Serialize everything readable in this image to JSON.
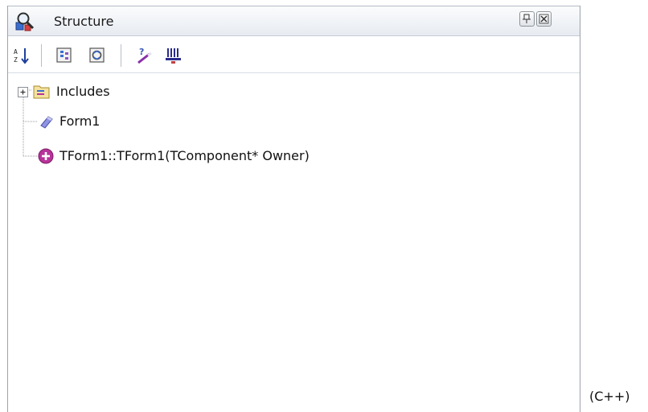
{
  "panel": {
    "title": "Structure",
    "title_icon": "structure-magnifier-icon",
    "buttons": {
      "pin_icon": "pin-icon",
      "close_icon": "close-icon"
    }
  },
  "toolbar": {
    "items": [
      {
        "name": "sort-alphabetical-button",
        "icon": "sort-az-icon"
      },
      {
        "name": "group-by-type-button",
        "icon": "group-icon"
      },
      {
        "name": "show-visibility-button",
        "icon": "filter-icon"
      },
      {
        "name": "help-insight-button",
        "icon": "help-wand-icon"
      },
      {
        "name": "show-members-button",
        "icon": "columns-icon"
      }
    ]
  },
  "tree": {
    "nodes": [
      {
        "label": "Includes",
        "icon": "folder-icon",
        "expandable": true
      },
      {
        "label": "Form1",
        "icon": "field-diamond-icon",
        "expandable": false
      },
      {
        "label": "TForm1::TForm1(TComponent* Owner)",
        "icon": "constructor-plus-icon",
        "expandable": false
      }
    ]
  },
  "caption": "(C++)",
  "colors": {
    "folder": "#e9d27a",
    "diamond": "#7a7fd6",
    "constructor": "#b8339b",
    "tree_lines": "#9a9a9a"
  }
}
